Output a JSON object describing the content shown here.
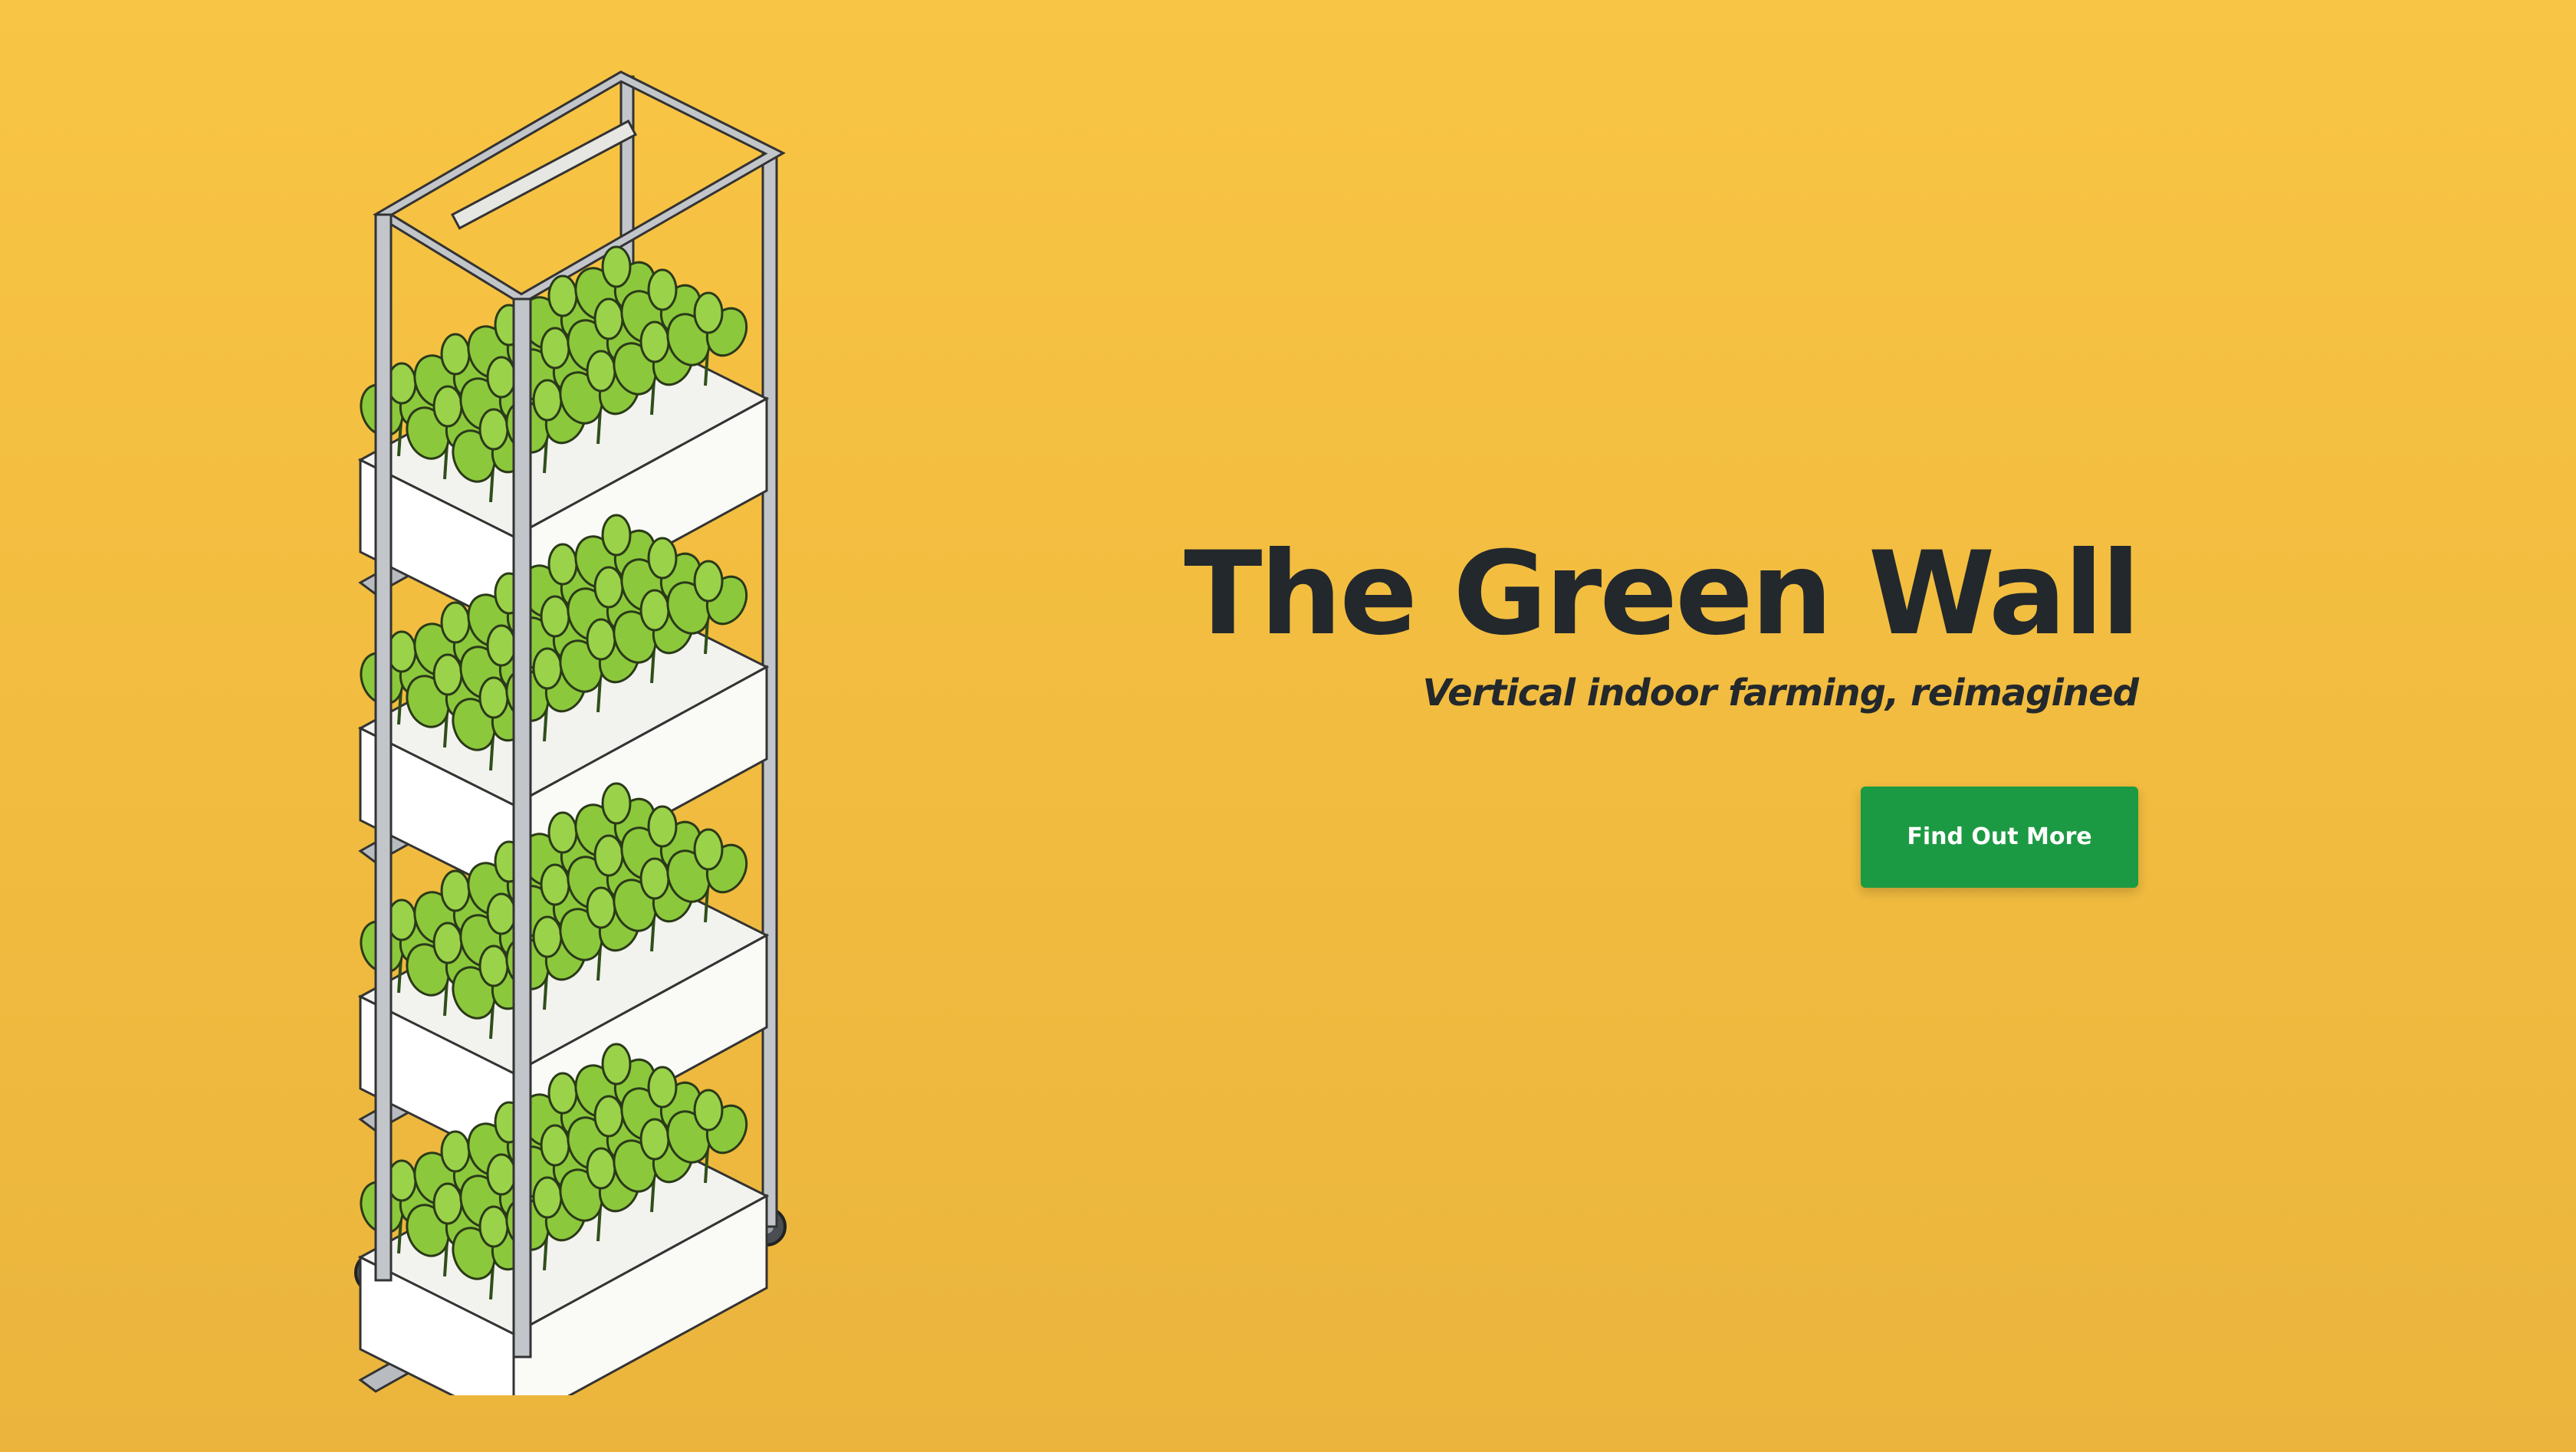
{
  "hero": {
    "title": "The Green Wall",
    "subtitle": "Vertical indoor farming, reimagined",
    "cta_label": "Find Out More",
    "image_alt": "green-wall-rack-illustration"
  },
  "colors": {
    "background": "#f4be42",
    "title_text": "#23282c",
    "cta_background": "#1c9a43",
    "cta_text": "#ffffff",
    "leaf": "#8cc83c",
    "frame": "#b8bcc0",
    "planter": "#ffffff"
  }
}
